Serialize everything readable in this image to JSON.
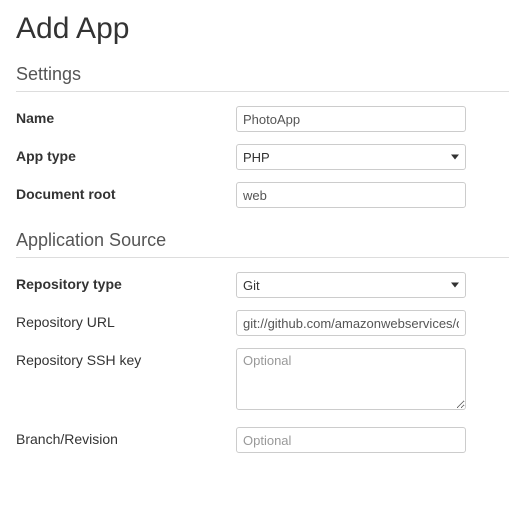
{
  "title": "Add App",
  "sections": {
    "settings": {
      "header": "Settings",
      "name_label": "Name",
      "name_value": "PhotoApp",
      "app_type_label": "App type",
      "app_type_value": "PHP",
      "doc_root_label": "Document root",
      "doc_root_value": "web"
    },
    "source": {
      "header": "Application Source",
      "repo_type_label": "Repository type",
      "repo_type_value": "Git",
      "repo_url_label": "Repository URL",
      "repo_url_value": "git://github.com/amazonwebservices/op",
      "ssh_key_label": "Repository SSH key",
      "ssh_key_value": "",
      "ssh_key_placeholder": "Optional",
      "branch_label": "Branch/Revision",
      "branch_value": "",
      "branch_placeholder": "Optional"
    }
  }
}
